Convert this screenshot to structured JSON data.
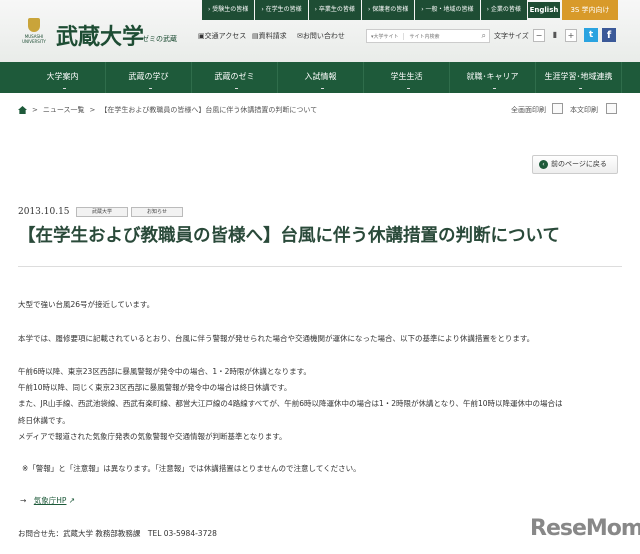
{
  "topbar": {
    "links": [
      "› 受験生の皆様",
      "› 在学生の皆様",
      "› 卒業生の皆様",
      "› 保護者の皆様",
      "› 一般・地域の皆様",
      "› 企業の皆様"
    ],
    "english": "English",
    "gakunai": "3S 学内向け"
  },
  "logo": {
    "ja": "武蔵大学",
    "en": "MUSASHI UNIVERSITY",
    "sub": "ゼミの武蔵"
  },
  "utility": {
    "access": "交通アクセス",
    "request": "資料請求",
    "contact": "お問い合わせ",
    "search_scope": "▾大学サイト",
    "search_placeholder": "サイト内検索",
    "font_size": "文字サイズ",
    "minus": "−",
    "plus": "+"
  },
  "nav": [
    "大学案内",
    "武蔵の学び",
    "武蔵のゼミ",
    "入試情報",
    "学生生活",
    "就職･キャリア",
    "生涯学習･地域連携"
  ],
  "breadcrumb": {
    "sep": ">",
    "list": "ニュース一覧",
    "current": "【在学生および教職員の皆様へ】台風に伴う休講措置の判断について"
  },
  "print": {
    "full": "全画面印刷",
    "body": "本文印刷"
  },
  "back_button": "前のページに戻る",
  "article": {
    "date": "2013.10.15",
    "tags": [
      "武蔵大学",
      "お知らせ"
    ],
    "title": "【在学生および教職員の皆様へ】台風に伴う休講措置の判断について",
    "paragraphs": [
      "大型で強い台風26号が接近しています。",
      "本学では、履修要項に記載されているとおり、台風に伴う警報が発せられた場合や交通機関が運休になった場合、以下の基準により休講措置をとります。",
      "午前6時以降、東京23区西部に暴風警報が発令中の場合、1・2時限が休講となります。",
      "午前10時以降、同じく東京23区西部に暴風警報が発令中の場合は終日休講です。",
      "また、JR山手線、西武池袋線、西武有楽町線、都営大江戸線の4路線すべてが、午前6時以降運休中の場合は1・2時限が休講となり、午前10時以降運休中の場合は",
      "終日休講です。",
      "メディアで報道された気象庁発表の気象警報や交通情報が判断基準となります。"
    ],
    "note": "※「警報」と「注意報」は異なります。「注意報」では休講措置はとりませんので注意してください。",
    "link_arrow": "→",
    "link": "気象庁HP",
    "contact": "お問合せ先：武蔵大学 教務部教務課　TEL 03-5984-3728"
  },
  "watermark": "ReseMom"
}
